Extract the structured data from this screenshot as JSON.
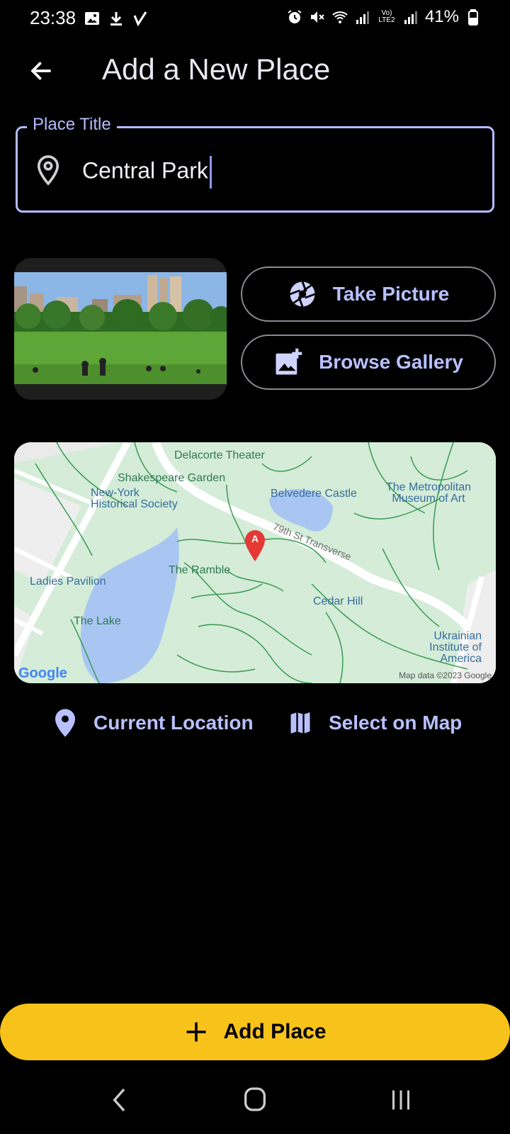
{
  "status_bar": {
    "time": "23:38",
    "battery_percent": "41%",
    "lte_label": "Vo) LTE2",
    "icons_left": [
      "image-icon",
      "download-icon",
      "check-icon"
    ],
    "icons_right": [
      "alarm-icon",
      "mute-icon",
      "wifi-icon",
      "signal-icon",
      "signal-icon",
      "battery-icon"
    ]
  },
  "header": {
    "title": "Add a New Place",
    "back_icon": "arrow-back-icon"
  },
  "title_field": {
    "label": "Place Title",
    "value": "Central Park",
    "icon": "location-pin-outline-icon"
  },
  "image_actions": {
    "take_picture": "Take Picture",
    "browse_gallery": "Browse Gallery"
  },
  "map": {
    "labels": {
      "delacorte": "Delacorte Theater",
      "shakespeare": "Shakespeare Garden",
      "belvedere": "Belvedere Castle",
      "met": "The Metropolitan Museum of Art",
      "nyhs": "New-York Historical Society",
      "transverse": "79th St Transverse",
      "ramble": "The Ramble",
      "ladies": "Ladies Pavilion",
      "cedar": "Cedar Hill",
      "lake": "The Lake",
      "ukrainian": "Ukrainian Institute of America",
      "footer": "Map data ©2023 Google",
      "google_logo": "Google",
      "marker_letter": "A"
    },
    "colors": {
      "park": "#d4ecd8",
      "water": "#a9c6f3",
      "paths": "#3a9a52",
      "roads": "#ffffff",
      "marker": "#e53935"
    }
  },
  "location_actions": {
    "current_location": "Current Location",
    "select_on_map": "Select on Map"
  },
  "primary_action": {
    "label": "Add Place",
    "color": "#f7c21a"
  },
  "nav_bar": {
    "icons": [
      "nav-back-icon",
      "nav-home-icon",
      "nav-recents-icon"
    ]
  },
  "theme": {
    "accent": "#b4bbff",
    "background": "#000000"
  }
}
